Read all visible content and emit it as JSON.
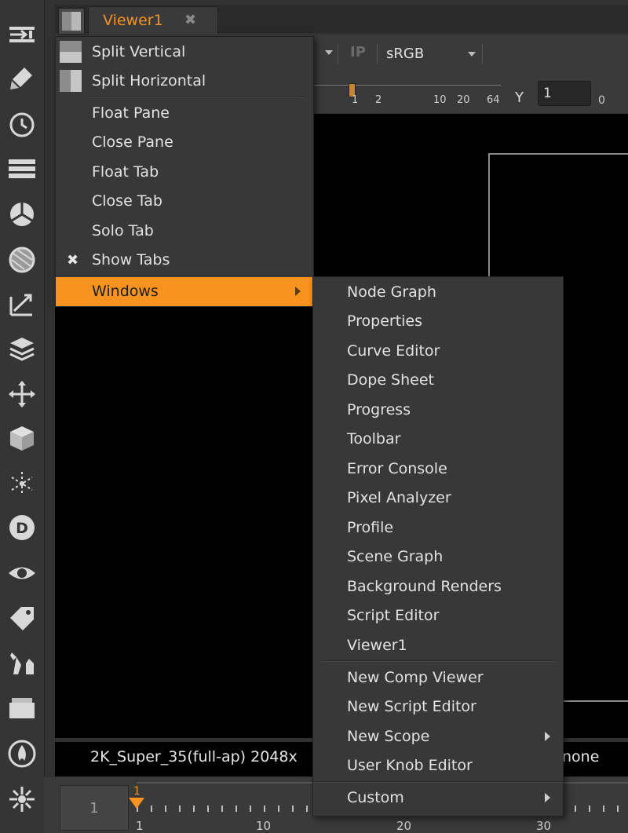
{
  "tab": {
    "label": "Viewer1",
    "close_glyph": "✖"
  },
  "controls": {
    "ip_label": "IP",
    "lut_value": "sRGB",
    "y_label": "Y",
    "y_value": "1",
    "zero_label": "0",
    "ruler_ticks": [
      "1",
      "2",
      "10",
      "20",
      "64"
    ]
  },
  "infobar": {
    "format_text": "2K_Super_35(full-ap) 2048x",
    "channel_text": "none"
  },
  "timeline": {
    "frame": "1",
    "marker": "1",
    "ticks": [
      "1",
      "10",
      "20",
      "30"
    ]
  },
  "pane_menu": {
    "items": [
      {
        "label": "Split Vertical"
      },
      {
        "label": "Split Horizontal"
      },
      {
        "label": "Float Pane"
      },
      {
        "label": "Close Pane"
      },
      {
        "label": "Float Tab"
      },
      {
        "label": "Close Tab"
      },
      {
        "label": "Solo Tab"
      },
      {
        "label": "Show Tabs",
        "checked": true
      },
      {
        "label": "Windows",
        "highlighted": true,
        "submenu": true
      }
    ],
    "check_glyph": "✖"
  },
  "windows_menu": {
    "items": [
      {
        "label": "Node Graph"
      },
      {
        "label": "Properties"
      },
      {
        "label": "Curve Editor"
      },
      {
        "label": "Dope Sheet"
      },
      {
        "label": "Progress"
      },
      {
        "label": "Toolbar"
      },
      {
        "label": "Error Console"
      },
      {
        "label": "Pixel Analyzer"
      },
      {
        "label": "Profile"
      },
      {
        "label": "Scene Graph"
      },
      {
        "label": "Background Renders"
      },
      {
        "label": "Script Editor"
      },
      {
        "label": "Viewer1"
      },
      {
        "label": "New Comp Viewer"
      },
      {
        "label": "New Script Editor"
      },
      {
        "label": "New Scope",
        "submenu": true
      },
      {
        "label": "User Knob Editor"
      },
      {
        "label": "Custom",
        "submenu": true
      }
    ]
  },
  "toolbar_icons": [
    "input-icon",
    "paint-icon",
    "time-icon",
    "channel-icon",
    "color-icon",
    "filter-icon",
    "keyer-icon",
    "merge-icon",
    "transform-icon",
    "3d-icon",
    "particles-icon",
    "deep-icon",
    "views-icon",
    "metadata-icon",
    "toolsets-icon",
    "other-icon",
    "furnace-icon",
    "plugins-icon"
  ],
  "colors": {
    "accent": "#f7931e",
    "menu_bg": "#383838",
    "viewer_bg": "#000000"
  }
}
